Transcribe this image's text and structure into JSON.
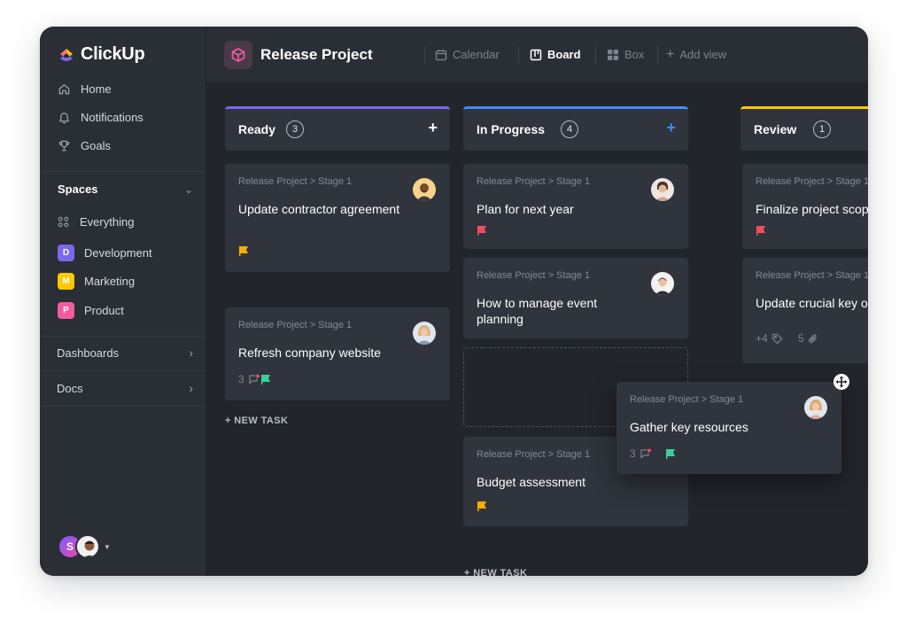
{
  "app": {
    "name": "ClickUp"
  },
  "sidebar": {
    "nav": [
      {
        "label": "Home",
        "icon": "home-icon"
      },
      {
        "label": "Notifications",
        "icon": "bell-icon"
      },
      {
        "label": "Goals",
        "icon": "trophy-icon"
      }
    ],
    "spaces_title": "Spaces",
    "everything_label": "Everything",
    "spaces": [
      {
        "letter": "D",
        "label": "Development",
        "color": "#7b68ee"
      },
      {
        "letter": "M",
        "label": "Marketing",
        "color": "#ffc800"
      },
      {
        "letter": "P",
        "label": "Product",
        "color": "#f45ba0"
      }
    ],
    "dashboards_label": "Dashboards",
    "docs_label": "Docs",
    "user_initial": "S"
  },
  "header": {
    "project_title": "Release Project",
    "views": [
      {
        "label": "Calendar",
        "icon": "calendar-icon",
        "active": false
      },
      {
        "label": "Board",
        "icon": "board-icon",
        "active": true
      },
      {
        "label": "Box",
        "icon": "box-icon",
        "active": false
      },
      {
        "label": "Add view",
        "icon": "plus-icon",
        "active": false
      }
    ]
  },
  "colors": {
    "ready": "#7b68ee",
    "in_progress": "#3e8ef7",
    "review": "#ffc800",
    "flag_yellow": "#f8ae00",
    "flag_red": "#f14d5f",
    "flag_green": "#3cd0a0"
  },
  "board": {
    "columns": [
      {
        "title": "Ready",
        "count": "3",
        "cards": [
          {
            "path": "Release Project > Stage 1",
            "title": "Update contractor agreement",
            "flag": "yellow"
          },
          {
            "path": "Release Project > Stage 1",
            "title": "Refresh company website",
            "comments": "3",
            "flag": "green"
          }
        ],
        "new_task": "+ NEW TASK"
      },
      {
        "title": "In Progress",
        "count": "4",
        "cards": [
          {
            "path": "Release Project > Stage 1",
            "title": "Plan for next year",
            "flag": "red"
          },
          {
            "path": "Release Project > Stage 1",
            "title": "How to manage event planning"
          },
          {
            "path": "Release Project > Stage 1",
            "title": "Budget assessment",
            "flag": "yellow"
          }
        ],
        "new_task": "+ NEW TASK"
      },
      {
        "title": "Review",
        "count": "1",
        "cards": [
          {
            "path": "Release Project > Stage 1",
            "title": "Finalize project scope",
            "flag": "red"
          },
          {
            "path": "Release Project > Stage 1",
            "title": "Update crucial key objectives",
            "tags": "+4",
            "attachments": "5"
          }
        ]
      }
    ],
    "dragging_card": {
      "path": "Release Project > Stage 1",
      "title": "Gather key resources",
      "comments": "3",
      "flag": "green"
    }
  }
}
